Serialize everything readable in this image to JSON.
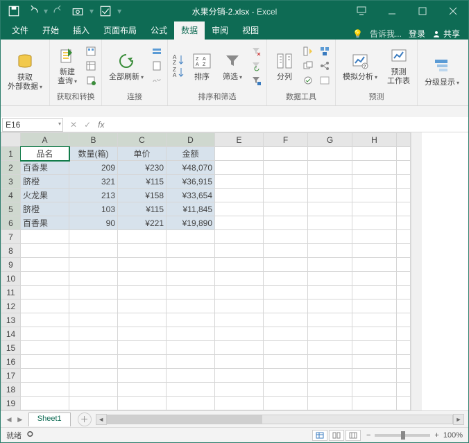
{
  "titlebar": {
    "filename": "水果分销-2.xlsx",
    "app": "Excel"
  },
  "tabs": {
    "file": "文件",
    "home": "开始",
    "insert": "插入",
    "layout": "页面布局",
    "formulas": "公式",
    "data": "数据",
    "review": "审阅",
    "view": "视图",
    "tellme": "告诉我...",
    "login": "登录",
    "share": "共享"
  },
  "ribbon": {
    "g1": {
      "ext_data": "获取\n外部数据",
      "label": ""
    },
    "g2": {
      "new_query": "新建\n查询",
      "label": "获取和转换"
    },
    "g3": {
      "refresh_all": "全部刷新",
      "label": "连接"
    },
    "g4": {
      "sort": "排序",
      "filter": "筛选",
      "label": "排序和筛选"
    },
    "g5": {
      "text_to_col": "分列",
      "label": "数据工具"
    },
    "g6": {
      "whatif": "模拟分析",
      "forecast": "预测\n工作表",
      "label": "预测"
    },
    "g7": {
      "outline": "分级显示",
      "label": ""
    }
  },
  "namebox": {
    "ref": "E16"
  },
  "sheet": {
    "columns": [
      "A",
      "B",
      "C",
      "D",
      "E",
      "F",
      "G",
      "H"
    ],
    "header_row": {
      "A": "品名",
      "B": "数量(箱)",
      "C": "单价",
      "D": "金额"
    },
    "rows": [
      {
        "A": "百香果",
        "B": "209",
        "C": "¥230",
        "D": "¥48,070"
      },
      {
        "A": "脐橙",
        "B": "321",
        "C": "¥115",
        "D": "¥36,915"
      },
      {
        "A": "火龙果",
        "B": "213",
        "C": "¥158",
        "D": "¥33,654"
      },
      {
        "A": "脐橙",
        "B": "103",
        "C": "¥115",
        "D": "¥11,845"
      },
      {
        "A": "百香果",
        "B": "90",
        "C": "¥221",
        "D": "¥19,890"
      }
    ],
    "selected_range": "A1:D6",
    "tab_name": "Sheet1"
  },
  "statusbar": {
    "ready": "就绪",
    "zoom": "100%"
  }
}
